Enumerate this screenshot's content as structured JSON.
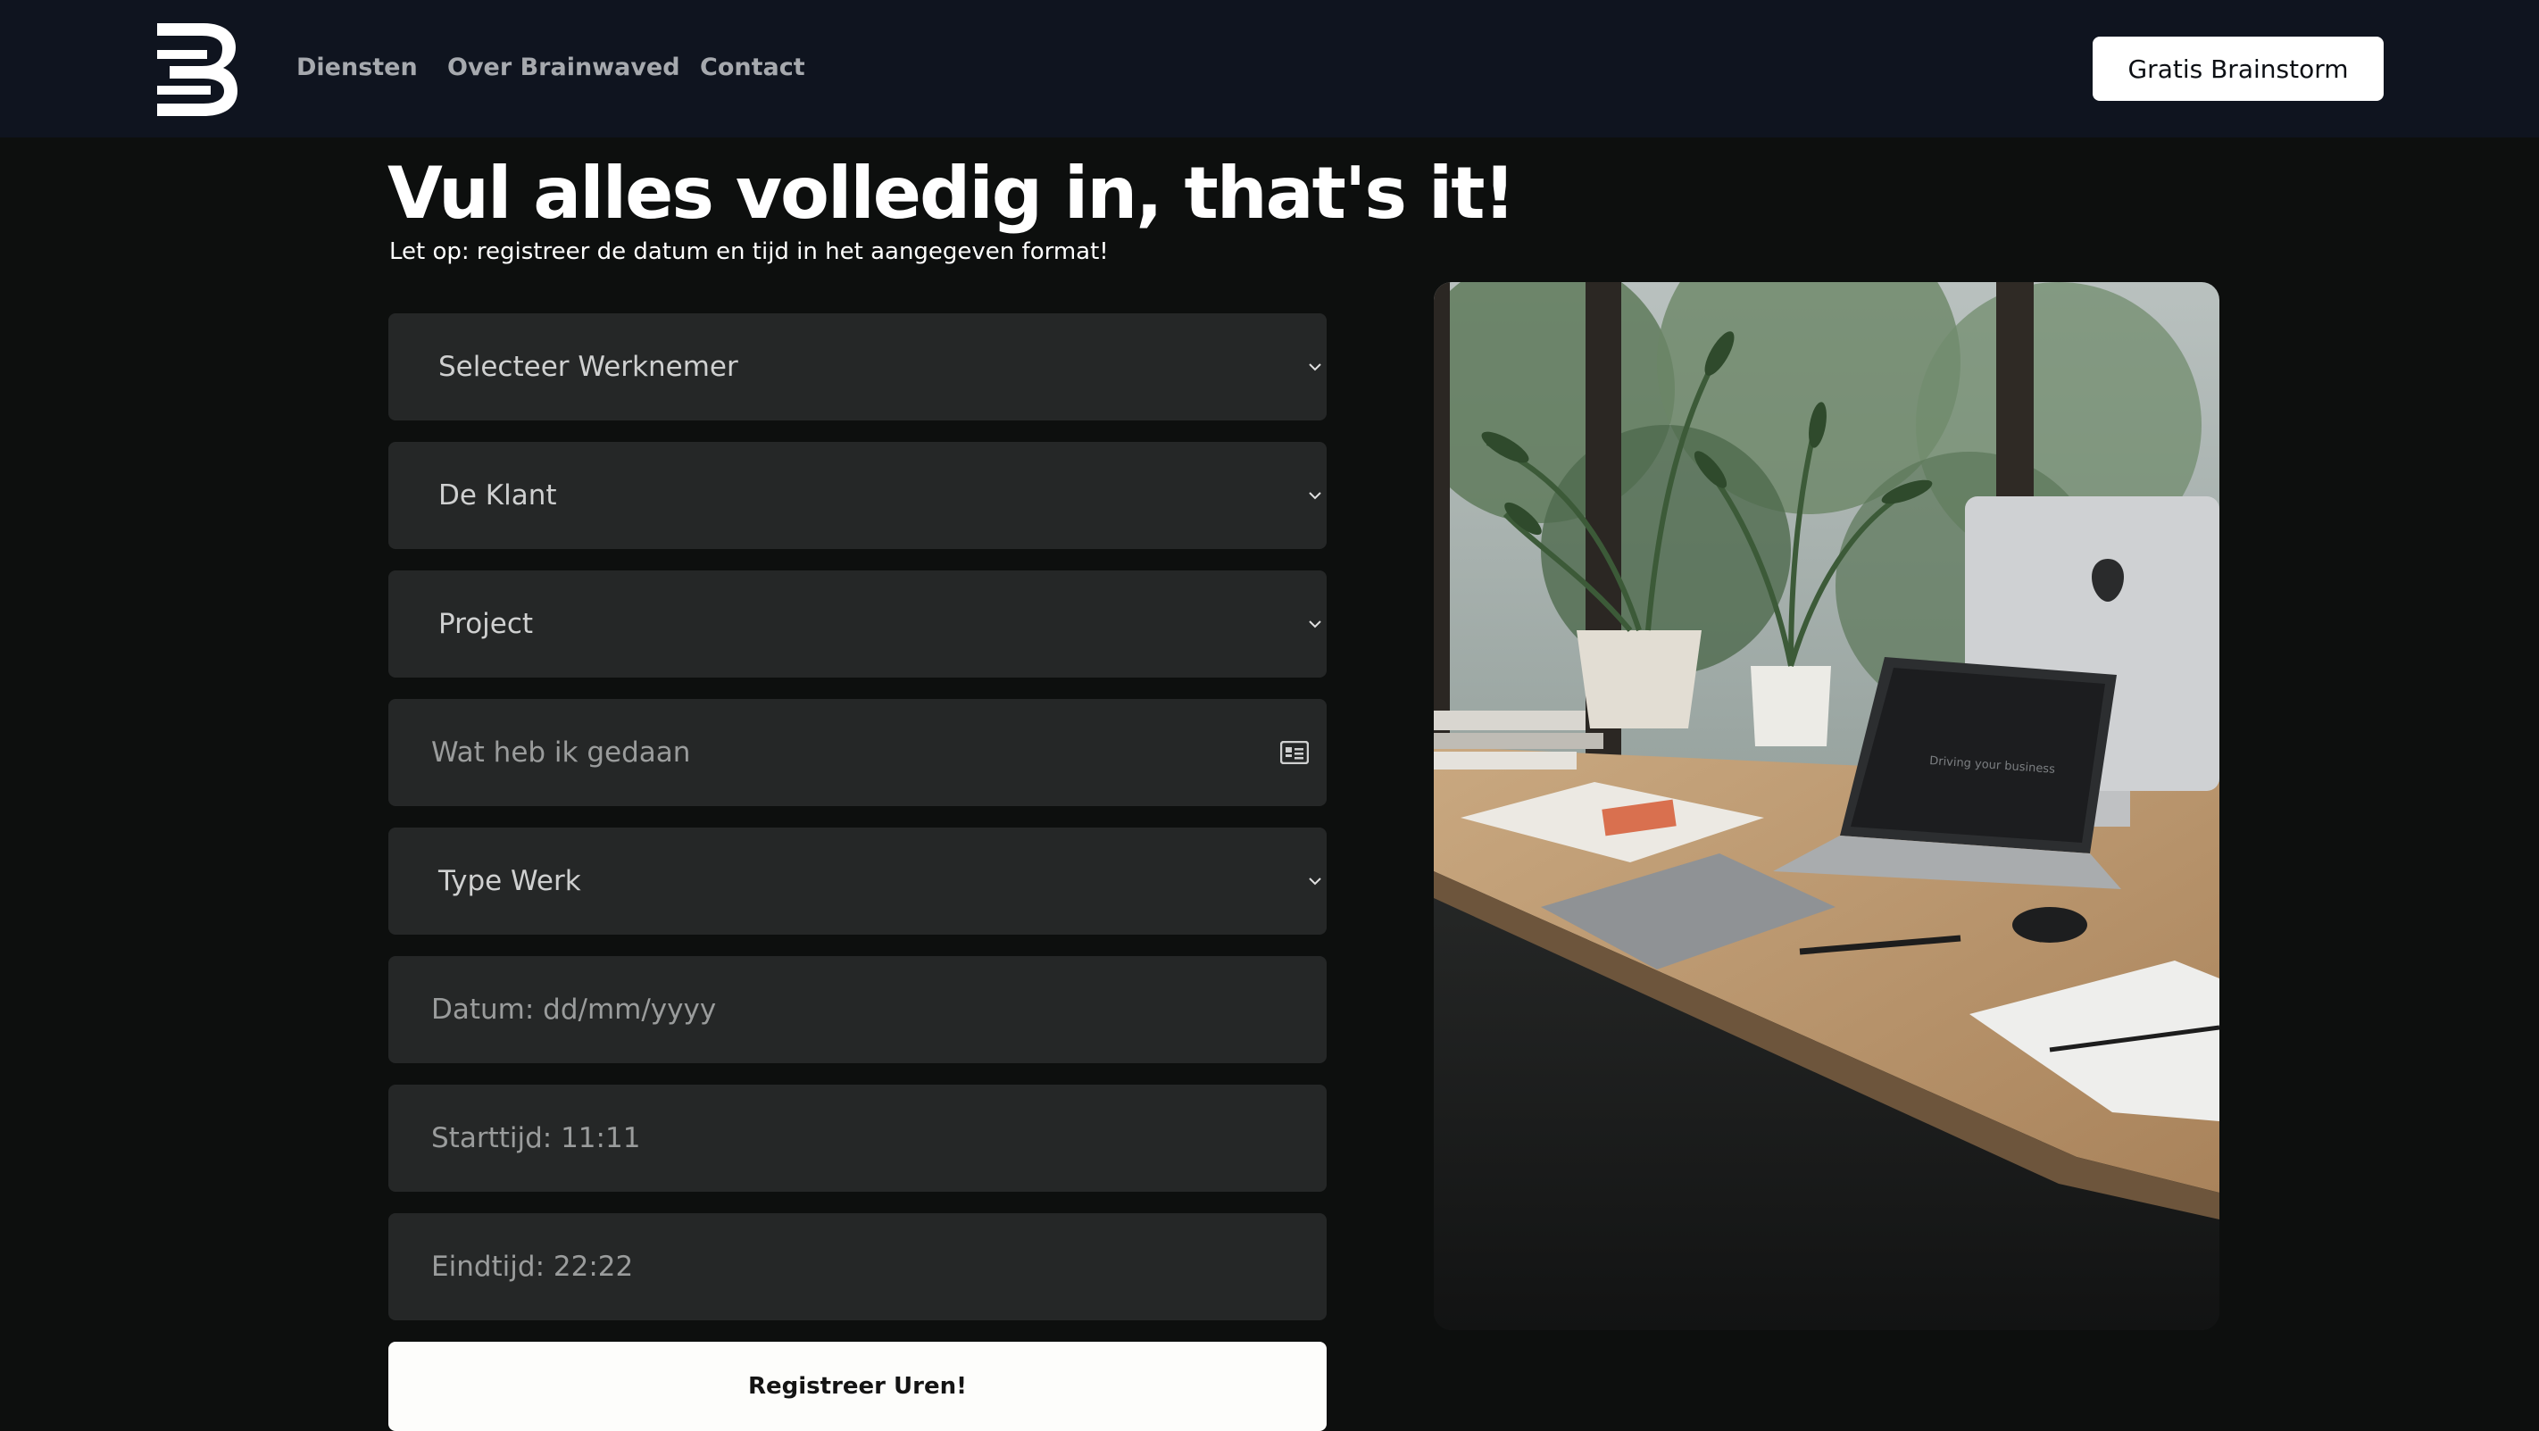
{
  "header": {
    "logo_icon": "brainwaved-b-logo",
    "nav": [
      {
        "label": "Diensten"
      },
      {
        "label": "Over Brainwaved"
      },
      {
        "label": "Contact"
      }
    ],
    "cta_label": "Gratis Brainstorm"
  },
  "main": {
    "title": "Vul alles volledig in, that's it!",
    "subtitle": "Let op: registreer de datum en tijd in het aangegeven format!"
  },
  "form": {
    "employee_select": "Selecteer Werknemer",
    "client_select": "De Klant",
    "project_select": "Project",
    "work_done_placeholder": "Wat heb ik gedaan",
    "work_type_select": "Type Werk",
    "date_placeholder": "Datum: dd/mm/yyyy",
    "start_placeholder": "Starttijd: 11:11",
    "end_placeholder": "Eindtijd: 22:22",
    "submit_label": "Registreer Uren!"
  },
  "photo": {
    "laptop_screen_text": "Driving your business"
  },
  "colors": {
    "header_bg": "#0f141f",
    "page_bg": "#0d0f0e",
    "field_bg": "#252727",
    "button_bg": "#ffffff"
  }
}
